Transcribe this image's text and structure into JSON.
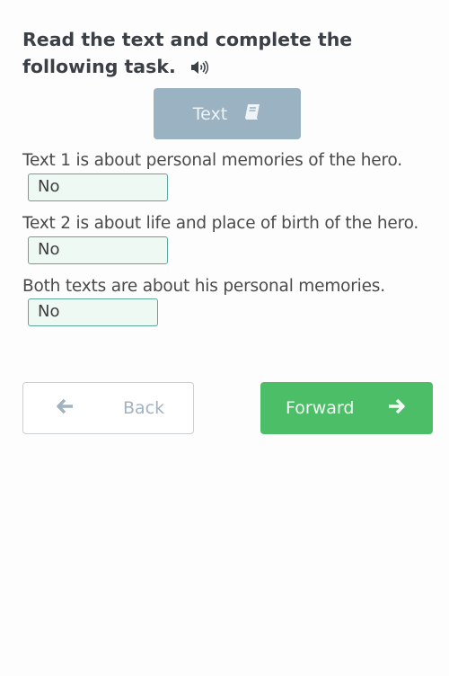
{
  "task": {
    "title": "Read the text and complete the following task.",
    "audio_icon": "speaker-icon"
  },
  "text_button": {
    "label": "Text",
    "icon": "book-icon"
  },
  "questions": [
    {
      "statement": "Text 1 is about personal memories of the hero.",
      "answer": "No"
    },
    {
      "statement": "Text 2 is about life and place of birth of the hero.",
      "answer": "No"
    },
    {
      "statement": "Both texts are about his personal memories.",
      "answer": "No"
    }
  ],
  "navigation": {
    "back_label": "Back",
    "back_icon": "arrow-left-icon",
    "forward_label": "Forward",
    "forward_icon": "arrow-right-icon"
  },
  "colors": {
    "forward": "#4cbe67",
    "text_button": "#9ab2c2",
    "answer_border": "#5aa99b",
    "answer_bg": "#eef9f4"
  }
}
